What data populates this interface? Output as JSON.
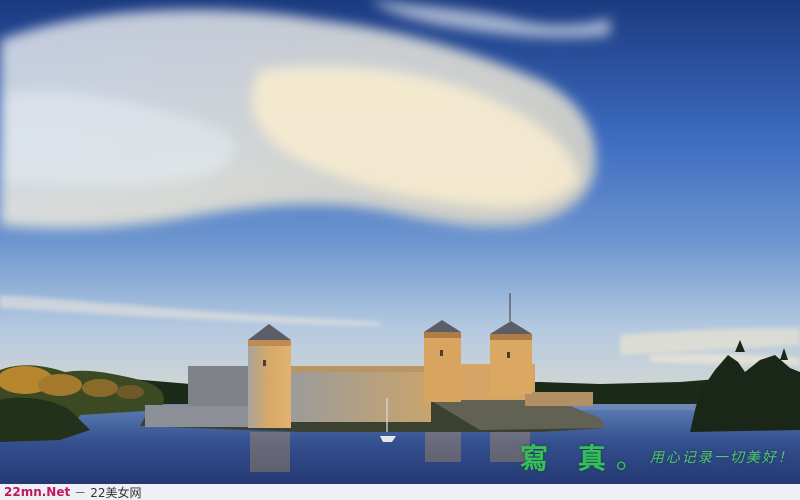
{
  "scene": {
    "subject": "castle-on-island",
    "colors": {
      "sky_top": "#1e3f86",
      "sky_mid": "#4f7fc8",
      "sky_horizon": "#b9cde3",
      "water": "#2a3f7a",
      "castle_lit": "#d9a25c",
      "castle_shadow": "#8c8f95",
      "trees": "#1f2d1a"
    }
  },
  "watermark": {
    "big_text": "寫 真",
    "dot": "。",
    "slogan": "用心记录一切美好！"
  },
  "footer": {
    "site": "22mn.Net",
    "separator": "－",
    "name": "22美女网"
  }
}
